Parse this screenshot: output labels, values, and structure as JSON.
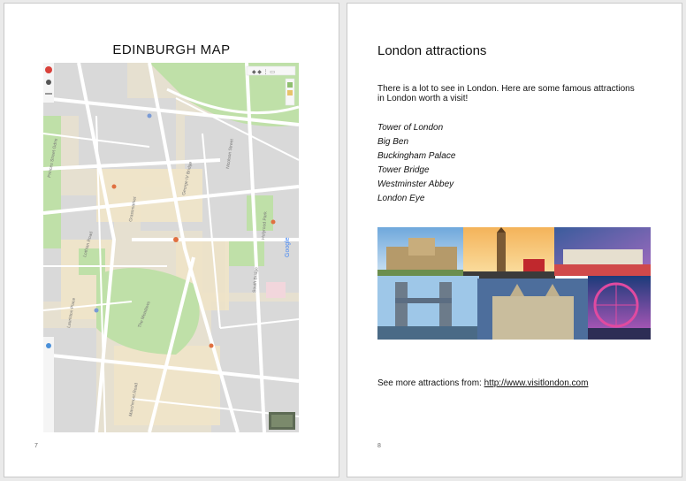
{
  "left_page": {
    "title": "EDINBURGH MAP",
    "page_number": "7",
    "map": {
      "street_labels": [
        "Princes Street Gardens",
        "Lothian Road",
        "Grassmarket",
        "The Meadows",
        "George IV Bridge",
        "Nicolson Street",
        "South Bridge",
        "Lauriston Place",
        "Marchmont Road",
        "Holyrood Park"
      ],
      "controls": [
        "layers-icon",
        "zoom-in-icon",
        "zoom-out-icon",
        "street-view-icon",
        "fullscreen-icon"
      ]
    }
  },
  "right_page": {
    "title": "London attractions",
    "intro": "There is a lot to see in London. Here are some famous attractions in London worth a visit!",
    "attractions": [
      "Tower of London",
      "Big Ben",
      "Buckingham Palace",
      "Tower Bridge",
      "Westminster Abbey",
      "London Eye"
    ],
    "footer_text": "See more attractions from: ",
    "footer_link": "http://www.visitlondon.com",
    "page_number": "8"
  },
  "colors": {
    "map_base": "#e9e3d4",
    "map_park": "#b9dca0",
    "map_road": "#ffffff",
    "map_block": "#d8d8d8"
  }
}
